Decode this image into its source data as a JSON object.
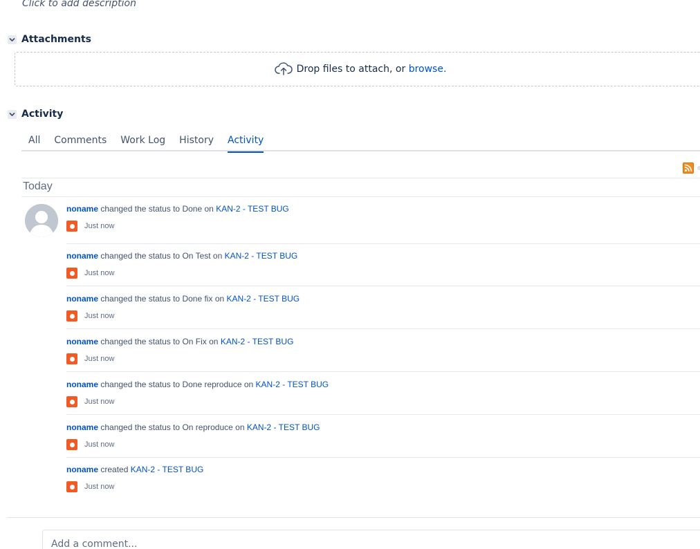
{
  "description_placeholder": "Click to add description",
  "attachments": {
    "title": "Attachments",
    "drop_text": "Drop files to attach, or",
    "browse_link": "browse."
  },
  "activity": {
    "title": "Activity",
    "tabs": [
      {
        "label": "All"
      },
      {
        "label": "Comments"
      },
      {
        "label": "Work Log"
      },
      {
        "label": "History"
      },
      {
        "label": "Activity",
        "active": true
      }
    ],
    "day_label": "Today",
    "entries": [
      {
        "user": "noname",
        "action": "changed the status to Done",
        "prep": "on",
        "issue": "KAN-2 - TEST BUG",
        "time": "Just now"
      },
      {
        "user": "noname",
        "action": "changed the status to On Test",
        "prep": "on",
        "issue": "KAN-2 - TEST BUG",
        "time": "Just now"
      },
      {
        "user": "noname",
        "action": "changed the status to Done fix",
        "prep": "on",
        "issue": "KAN-2 - TEST BUG",
        "time": "Just now"
      },
      {
        "user": "noname",
        "action": "changed the status to On Fix",
        "prep": "on",
        "issue": "KAN-2 - TEST BUG",
        "time": "Just now"
      },
      {
        "user": "noname",
        "action": "changed the status to Done reproduce",
        "prep": "on",
        "issue": "KAN-2 - TEST BUG",
        "time": "Just now"
      },
      {
        "user": "noname",
        "action": "changed the status to On reproduce",
        "prep": "on",
        "issue": "KAN-2 - TEST BUG",
        "time": "Just now"
      },
      {
        "user": "noname",
        "action": "created",
        "prep": "",
        "issue": "KAN-2 - TEST BUG",
        "time": "Just now"
      }
    ]
  },
  "comment_placeholder": "Add a comment...",
  "colors": {
    "link": "#0052cc",
    "app_icon": "#f15a24",
    "rss": "#f38b1f"
  },
  "icons": {
    "section_toggle": "chevron-down-icon",
    "upload": "cloud-upload-icon",
    "feed": "rss-feed-icon",
    "entry_app": "app-icon",
    "avatar": "default-avatar"
  }
}
